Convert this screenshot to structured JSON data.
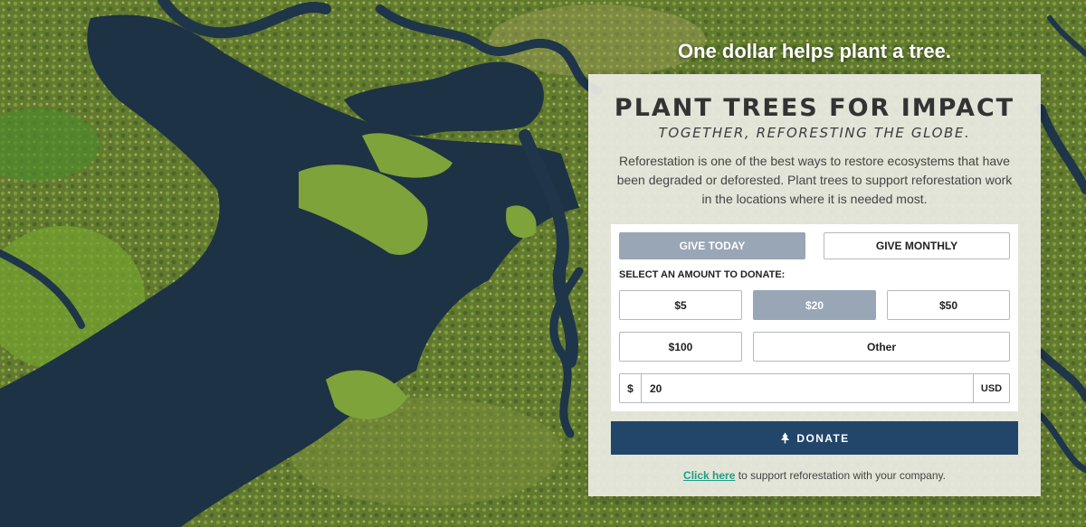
{
  "headline": "One dollar helps plant a tree.",
  "card": {
    "title": "PLANT TREES FOR IMPACT",
    "subtitle": "TOGETHER, REFORESTING THE GLOBE.",
    "description": "Reforestation is one of the best ways to restore ecosystems that have been degraded or deforested. Plant trees to support reforestation work in the locations where it is needed most."
  },
  "frequency_tabs": [
    {
      "label": "GIVE TODAY",
      "selected": true
    },
    {
      "label": "GIVE MONTHLY",
      "selected": false
    }
  ],
  "amount_label": "SELECT AN AMOUNT TO DONATE:",
  "amounts": [
    {
      "label": "$5",
      "selected": false
    },
    {
      "label": "$20",
      "selected": true
    },
    {
      "label": "$50",
      "selected": false
    },
    {
      "label": "$100",
      "selected": false
    },
    {
      "label": "Other",
      "selected": false
    }
  ],
  "amount_field": {
    "prefix": "$",
    "value": "20",
    "currency": "USD"
  },
  "donate": {
    "label": "DONATE",
    "icon": "tree-icon"
  },
  "footer": {
    "link": "Click here",
    "text": " to support reforestation with your company."
  },
  "colors": {
    "selected_fill": "#98a6b6",
    "donate_fill": "#22466a",
    "link": "#1a9f86",
    "water": "#1e3242",
    "vegetation": "#5f7a2e"
  }
}
